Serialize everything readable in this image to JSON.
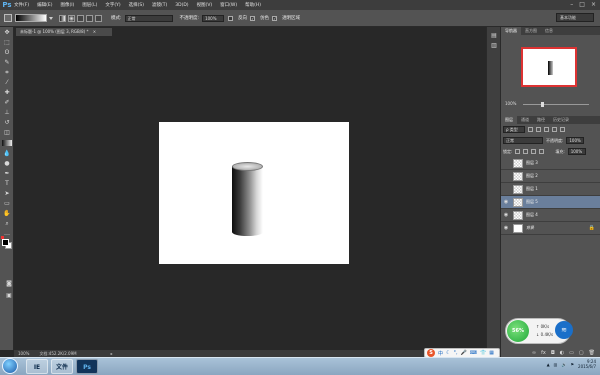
{
  "app": {
    "logo": "Ps"
  },
  "menu": [
    "文件(F)",
    "编辑(E)",
    "图像(I)",
    "图层(L)",
    "文字(Y)",
    "选择(S)",
    "滤镜(T)",
    "3D(D)",
    "视图(V)",
    "窗口(W)",
    "帮助(H)"
  ],
  "window_controls": {
    "minimize": "–",
    "maximize": "□",
    "close": "×"
  },
  "options_bar": {
    "mode_label": "模式:",
    "mode_value": "正常",
    "opacity_label": "不透明度:",
    "opacity_value": "100%",
    "reverse_label": "反向",
    "dither_label": "仿色",
    "transparency_label": "透明区域",
    "workspace": "基本功能"
  },
  "document": {
    "tab_title": "未标题-1 @ 100% (图层 3, RGB/8) *",
    "close": "×"
  },
  "status_bar": {
    "zoom": "100%",
    "doc_info": "文档:452.2K/2.09M"
  },
  "panels": {
    "top_tabs": [
      "导航器",
      "直方图",
      "信息"
    ],
    "navigator_zoom": "100%",
    "layer_tabs": [
      "图层",
      "通道",
      "路径",
      "历史记录"
    ],
    "kind_label": "ρ 类型",
    "blend_mode": "正常",
    "opacity_label": "不透明度:",
    "opacity_value": "100%",
    "lock_label": "锁定:",
    "fill_label": "填充:",
    "fill_value": "100%",
    "layers": [
      {
        "name": "图层 3",
        "visible": false,
        "selected": false
      },
      {
        "name": "图层 2",
        "visible": false,
        "selected": false
      },
      {
        "name": "图层 1",
        "visible": false,
        "selected": false
      },
      {
        "name": "图层 5",
        "visible": true,
        "selected": true
      },
      {
        "name": "图层 4",
        "visible": true,
        "selected": false
      },
      {
        "name": "背景",
        "visible": true,
        "selected": false,
        "locked": true
      }
    ]
  },
  "overlay": {
    "percent": "56%",
    "upload": "↑ 0K/s",
    "download": "↓ 0.4K/s"
  },
  "ime": {
    "label": "S",
    "mode": "中"
  },
  "taskbar": {
    "apps": [
      "IE",
      "文件",
      "Ps"
    ],
    "time": "9:24",
    "date": "2015/6/7"
  },
  "colors": {
    "accent": "#5fb3ee",
    "selected_layer": "#6a7f9c",
    "canvas": "#ffffff"
  }
}
